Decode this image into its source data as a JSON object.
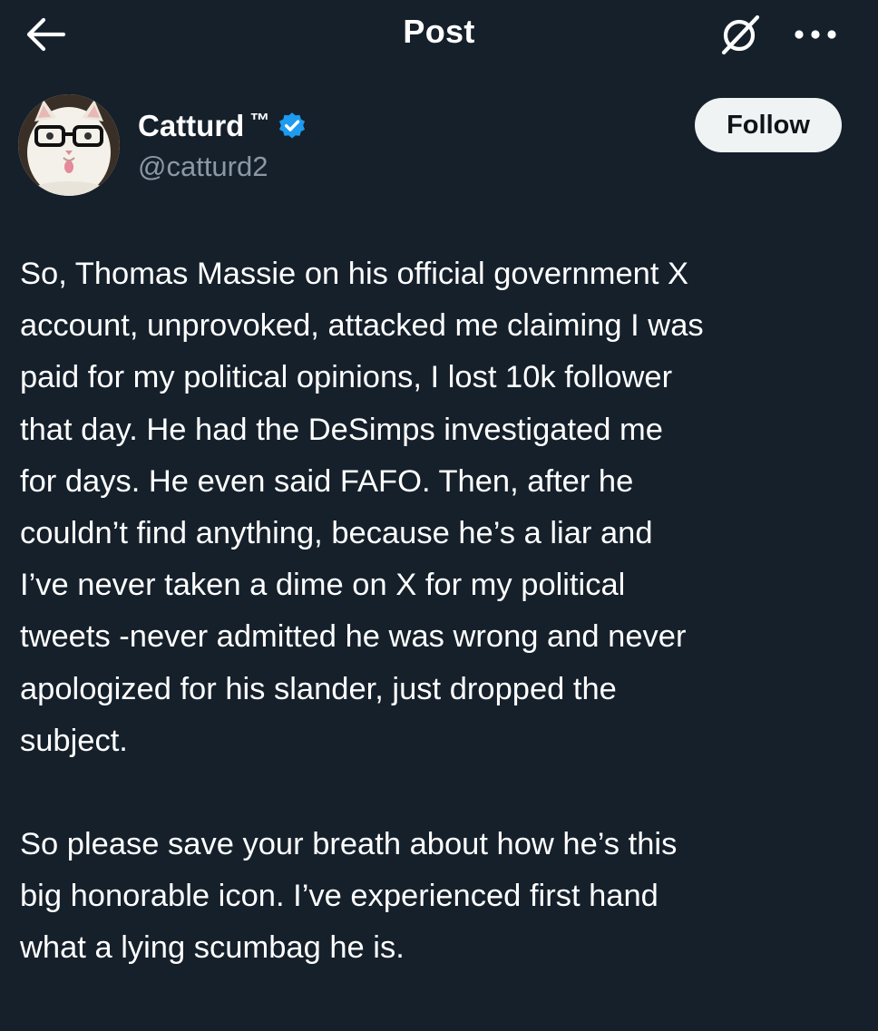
{
  "header": {
    "title": "Post",
    "back_icon": "arrow-left-icon",
    "grok_icon": "grok-icon",
    "more_icon": "more-horizontal-icon"
  },
  "author": {
    "display_name": "Catturd",
    "name_suffix": "™",
    "handle": "@catturd2",
    "verified": true,
    "verified_color": "#1d9bf0",
    "follow_label": "Follow"
  },
  "post": {
    "lines_paragraph_1": [
      "So, Thomas Massie on his official government X",
      "account, unprovoked, attacked me claiming I was",
      "paid for my political opinions, I lost 10k follower",
      "that day. He had the DeSimps investigated me",
      "for days. He even said FAFO. Then, after he",
      "couldn’t find anything, because he’s a liar and",
      "I’ve never taken a dime on X for my political",
      "tweets -never admitted he was wrong and never",
      "apologized for his slander, just dropped the",
      "subject."
    ],
    "lines_paragraph_2": [
      "So please save your breath about how he’s this",
      "big honorable icon. I’ve experienced first hand",
      "what a lying scumbag he is."
    ]
  },
  "theme": {
    "background": "#15202b",
    "text": "#ffffff",
    "secondary_text": "#8b98a5",
    "follow_button_bg": "#eff3f4"
  }
}
